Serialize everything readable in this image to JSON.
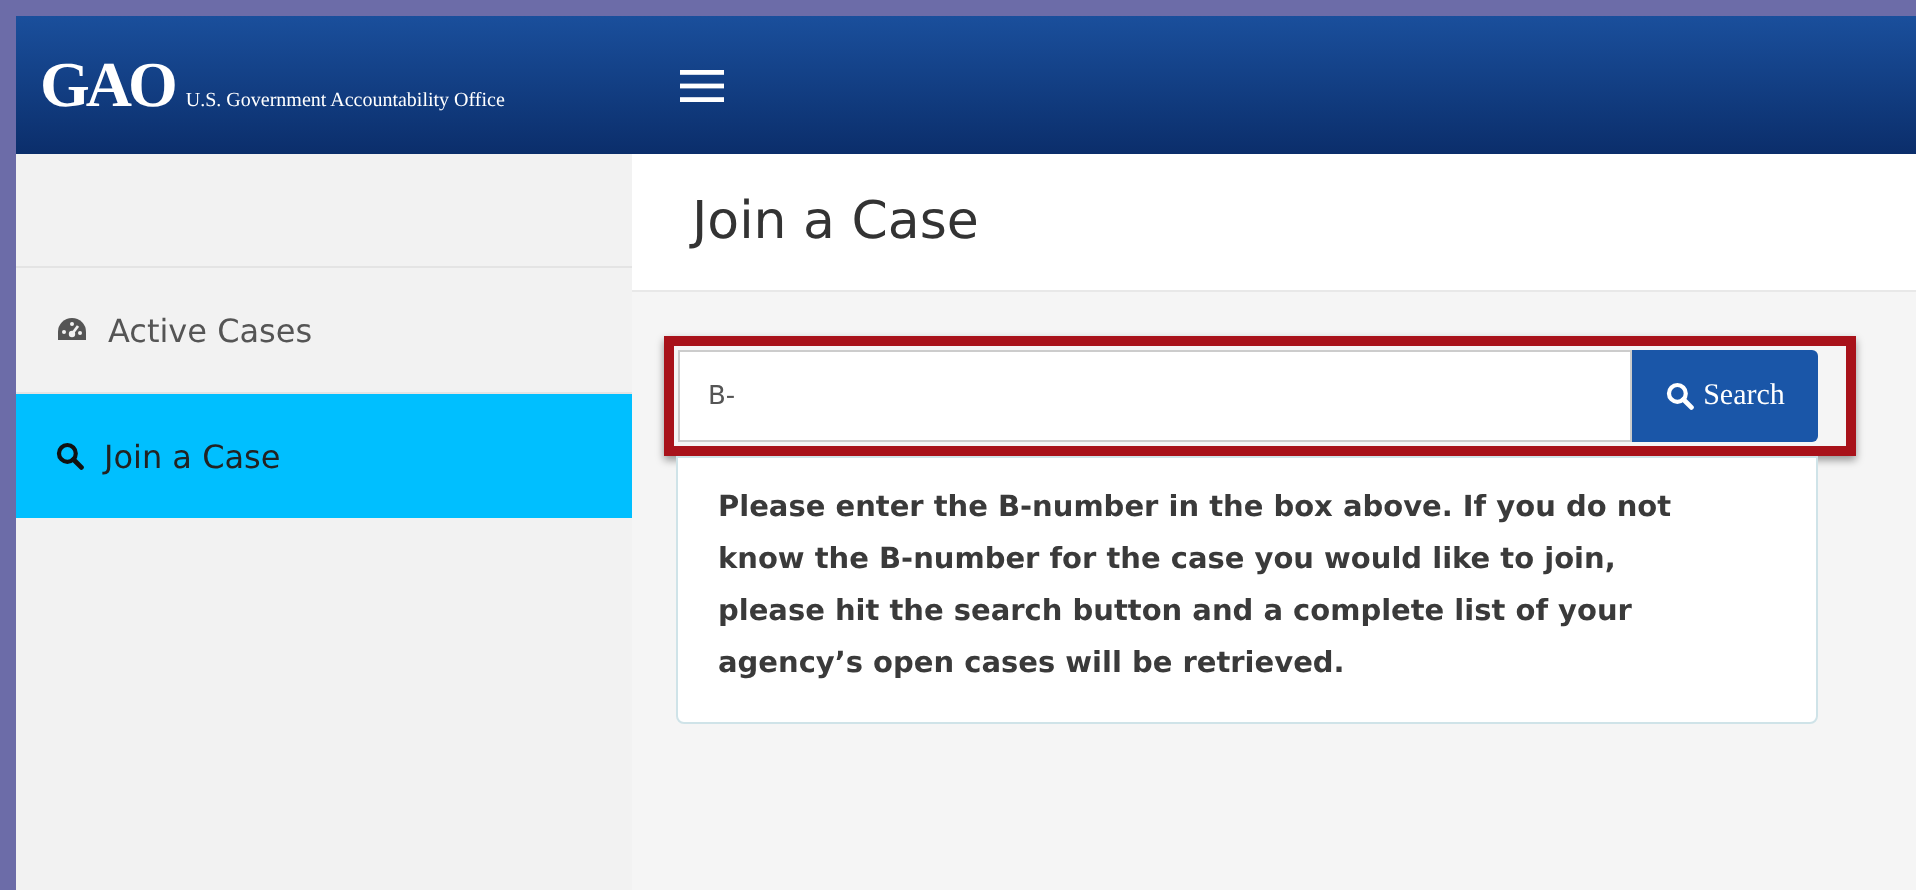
{
  "header": {
    "logo": "GAO",
    "agency": "U.S. Government Accountability Office"
  },
  "sidebar": {
    "items": [
      {
        "label": "Active Cases",
        "kind": "dashboard",
        "selected": false
      },
      {
        "label": "Join a Case",
        "kind": "search",
        "selected": true
      }
    ]
  },
  "page": {
    "title": "Join a Case",
    "search": {
      "value": "B-",
      "button": "Search"
    },
    "help": "Please enter the B-number in the box above. If you do not know the B-number for the case you would like to join, please hit the search button and a complete list of your agency’s open cases will be retrieved."
  }
}
